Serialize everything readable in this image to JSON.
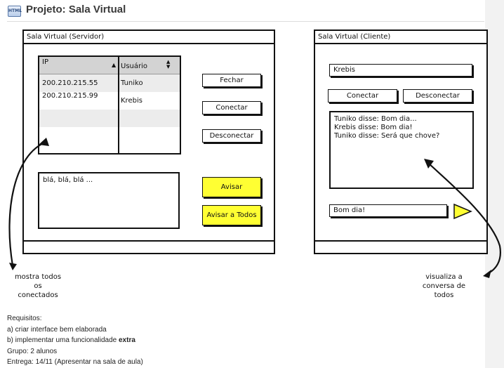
{
  "page": {
    "title": "Projeto: Sala Virtual",
    "icon": "html-file-icon",
    "icon_text": "HTML"
  },
  "server_window": {
    "title": "Sala Virtual (Servidor)",
    "table": {
      "columns": [
        "IP",
        "Usuário"
      ],
      "rows": [
        {
          "ip": "200.210.215.55",
          "user": "Tuniko"
        },
        {
          "ip": "200.210.215.99",
          "user": "Krebis"
        },
        {
          "ip": "",
          "user": ""
        },
        {
          "ip": "",
          "user": ""
        }
      ]
    },
    "buttons": {
      "close": "Fechar",
      "connect": "Conectar",
      "disconnect": "Desconectar",
      "notify": "Avisar",
      "notify_all": "Avisar a Todos"
    },
    "message_text": "blá, blá, blá ...",
    "colors": {
      "accent_button": "#ffff33"
    }
  },
  "client_window": {
    "title": "Sala Virtual (Cliente)",
    "username_value": "Krebis",
    "buttons": {
      "connect": "Conectar",
      "disconnect": "Desconectar"
    },
    "chat_lines": [
      "Tuniko disse: Bom dia...",
      "Krebis disse: Bom dia!",
      "Tuniko disse: Será que chove?"
    ],
    "message_value": "Bom dia!",
    "send_icon": "send-triangle-icon"
  },
  "annotations": {
    "left": [
      "mostra todos",
      "os",
      "conectados"
    ],
    "right": [
      "visualiza a",
      "conversa de",
      "todos"
    ]
  },
  "requirements": {
    "heading": "Requisitos:",
    "item_a": "a) criar interface bem elaborada",
    "item_b_prefix": "b) implementar uma funcionalidade ",
    "item_b_bold": "extra",
    "group": "Grupo: 2 alunos",
    "delivery": "Entrega: 14/11 (Apresentar na sala de aula)"
  }
}
